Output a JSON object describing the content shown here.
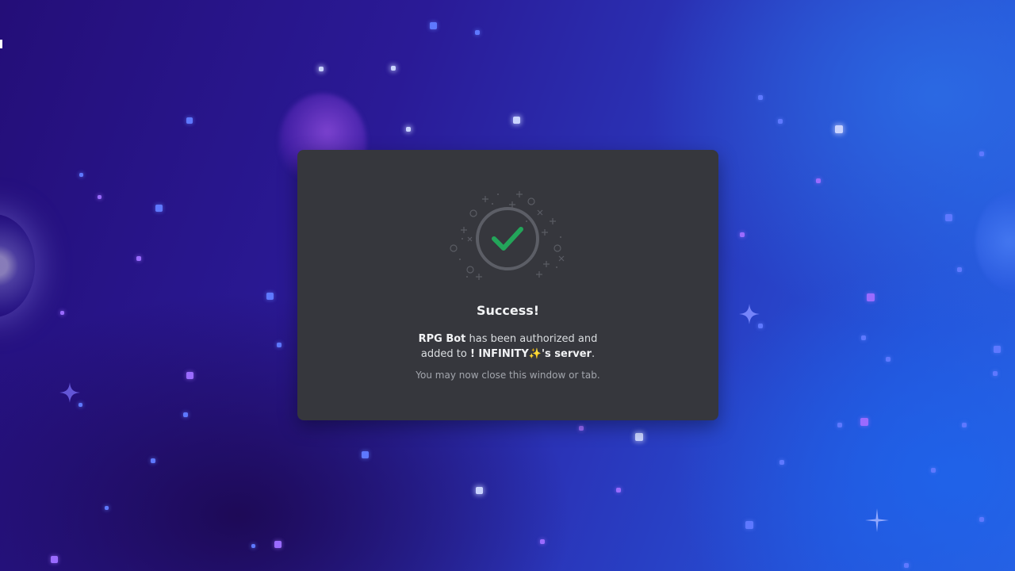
{
  "dialog": {
    "title": "Success!",
    "bot_name": "RPG Bot",
    "message_part1": " has been authorized and",
    "message_part2": "added to ",
    "server_name": "! INFINITY✨'s server",
    "message_end": ".",
    "hint": "You may now close this window or tab."
  },
  "icons": {
    "status_icon": "check-circle-icon",
    "decoration": "sparkles-decoration"
  },
  "colors": {
    "check_green": "#23a55a",
    "card_background": "#36373d",
    "ring_gray": "#5c5e66"
  }
}
